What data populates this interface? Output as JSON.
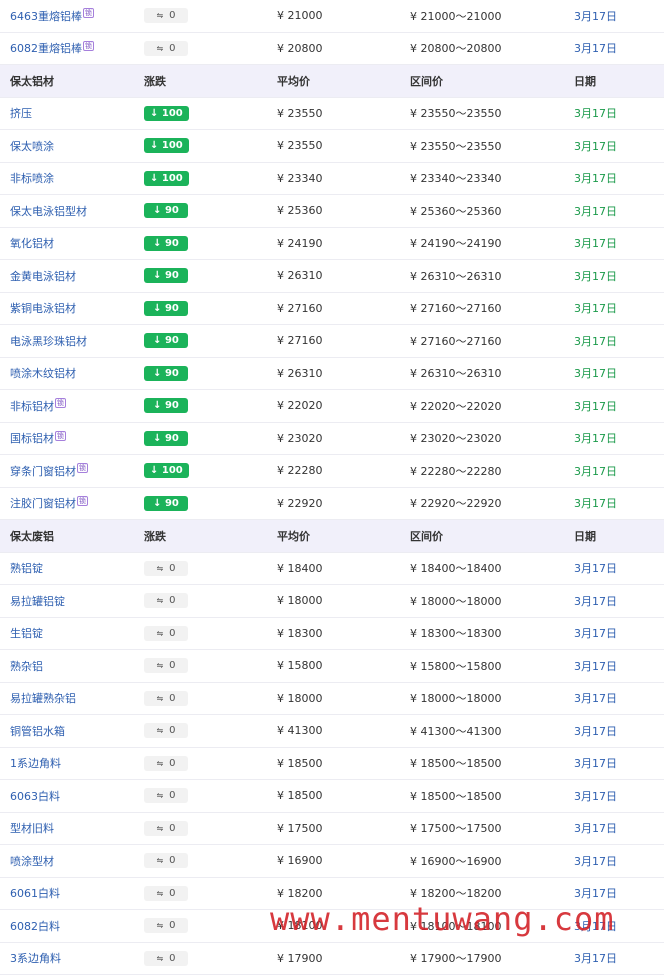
{
  "top_rows": [
    {
      "name": "6463重熔铝棒",
      "tag": "锁",
      "change": "0",
      "avg": "¥ 21000",
      "range": "¥ 21000～21000",
      "date": "3月17日",
      "style": "flat"
    },
    {
      "name": "6082重熔铝棒",
      "tag": "锁",
      "change": "0",
      "avg": "¥ 20800",
      "range": "¥ 20800～20800",
      "date": "3月17日",
      "style": "flat"
    }
  ],
  "section_profiles": {
    "header": {
      "c1": "保太铝材",
      "c2": "涨跌",
      "c3": "平均价",
      "c4": "区间价",
      "c5": "日期"
    },
    "rows": [
      {
        "name": "挤压",
        "change": "↓ 100",
        "avg": "¥ 23550",
        "range": "¥ 23550～23550",
        "date": "3月17日"
      },
      {
        "name": "保太喷涂",
        "change": "↓ 100",
        "avg": "¥ 23550",
        "range": "¥ 23550～23550",
        "date": "3月17日"
      },
      {
        "name": "非标喷涂",
        "change": "↓ 100",
        "avg": "¥ 23340",
        "range": "¥ 23340～23340",
        "date": "3月17日"
      },
      {
        "name": "保太电泳铝型材",
        "change": "↓ 90",
        "avg": "¥ 25360",
        "range": "¥ 25360～25360",
        "date": "3月17日"
      },
      {
        "name": "氧化铝材",
        "change": "↓ 90",
        "avg": "¥ 24190",
        "range": "¥ 24190～24190",
        "date": "3月17日"
      },
      {
        "name": "金黄电泳铝材",
        "change": "↓ 90",
        "avg": "¥ 26310",
        "range": "¥ 26310～26310",
        "date": "3月17日"
      },
      {
        "name": "紫铜电泳铝材",
        "change": "↓ 90",
        "avg": "¥ 27160",
        "range": "¥ 27160～27160",
        "date": "3月17日"
      },
      {
        "name": "电泳黑珍珠铝材",
        "change": "↓ 90",
        "avg": "¥ 27160",
        "range": "¥ 27160～27160",
        "date": "3月17日"
      },
      {
        "name": "喷涂木纹铝材",
        "change": "↓ 90",
        "avg": "¥ 26310",
        "range": "¥ 26310～26310",
        "date": "3月17日"
      },
      {
        "name": "非标铝材",
        "tag": "锁",
        "change": "↓ 90",
        "avg": "¥ 22020",
        "range": "¥ 22020～22020",
        "date": "3月17日"
      },
      {
        "name": "国标铝材",
        "tag": "锁",
        "change": "↓ 90",
        "avg": "¥ 23020",
        "range": "¥ 23020～23020",
        "date": "3月17日"
      },
      {
        "name": "穿条门窗铝材",
        "tag": "锁",
        "change": "↓ 100",
        "avg": "¥ 22280",
        "range": "¥ 22280～22280",
        "date": "3月17日"
      },
      {
        "name": "注胶门窗铝材",
        "tag": "锁",
        "change": "↓ 90",
        "avg": "¥ 22920",
        "range": "¥ 22920～22920",
        "date": "3月17日"
      }
    ]
  },
  "section_scrap": {
    "header": {
      "c1": "保太废铝",
      "c2": "涨跌",
      "c3": "平均价",
      "c4": "区间价",
      "c5": "日期"
    },
    "rows": [
      {
        "name": "熟铝锭",
        "change": "0",
        "avg": "¥ 18400",
        "range": "¥ 18400～18400",
        "date": "3月17日"
      },
      {
        "name": "易拉罐铝锭",
        "change": "0",
        "avg": "¥ 18000",
        "range": "¥ 18000～18000",
        "date": "3月17日"
      },
      {
        "name": "生铝锭",
        "change": "0",
        "avg": "¥ 18300",
        "range": "¥ 18300～18300",
        "date": "3月17日"
      },
      {
        "name": "熟杂铝",
        "change": "0",
        "avg": "¥ 15800",
        "range": "¥ 15800～15800",
        "date": "3月17日"
      },
      {
        "name": "易拉罐熟杂铝",
        "change": "0",
        "avg": "¥ 18000",
        "range": "¥ 18000～18000",
        "date": "3月17日"
      },
      {
        "name": "铜管铝水箱",
        "change": "0",
        "avg": "¥ 41300",
        "range": "¥ 41300～41300",
        "date": "3月17日"
      },
      {
        "name": "1系边角料",
        "change": "0",
        "avg": "¥ 18500",
        "range": "¥ 18500～18500",
        "date": "3月17日"
      },
      {
        "name": "6063白料",
        "change": "0",
        "avg": "¥ 18500",
        "range": "¥ 18500～18500",
        "date": "3月17日"
      },
      {
        "name": "型材旧料",
        "change": "0",
        "avg": "¥ 17500",
        "range": "¥ 17500～17500",
        "date": "3月17日"
      },
      {
        "name": "喷涂型材",
        "change": "0",
        "avg": "¥ 16900",
        "range": "¥ 16900～16900",
        "date": "3月17日"
      },
      {
        "name": "6061白料",
        "change": "0",
        "avg": "¥ 18200",
        "range": "¥ 18200～18200",
        "date": "3月17日"
      },
      {
        "name": "6082白料",
        "change": "0",
        "avg": "¥ 18100",
        "range": "¥ 18100～18100",
        "date": "3月17日"
      },
      {
        "name": "3系边角料",
        "change": "0",
        "avg": "¥ 17900",
        "range": "¥ 17900～17900",
        "date": "3月17日"
      }
    ]
  },
  "flat_prefix": "⇋",
  "watermark": "www.mentuwang.com",
  "colors": {
    "down": "#1bb35a",
    "link": "#2e5fb0",
    "header_bg": "#f1f0fa",
    "date_green": "#1a9a4a",
    "watermark": "#d3242a"
  }
}
